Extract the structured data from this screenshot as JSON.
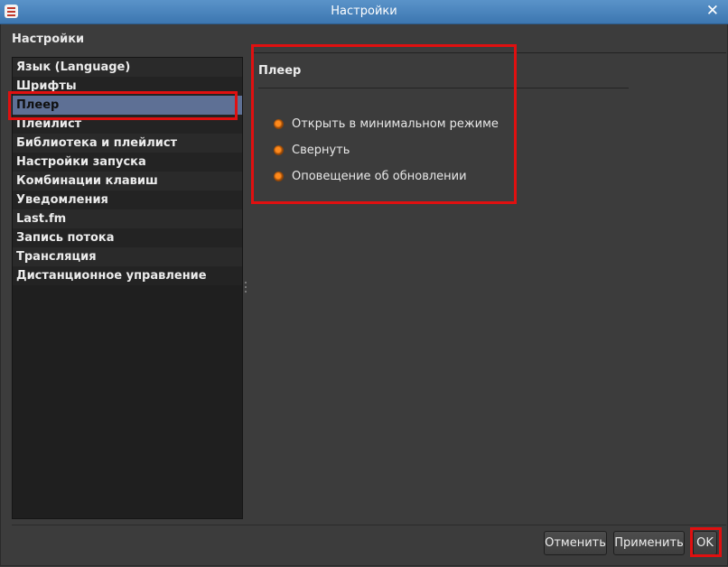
{
  "window": {
    "title": "Настройки",
    "close_glyph": "✕"
  },
  "heading": "Настройки",
  "sidebar": {
    "items": [
      {
        "label": "Язык (Language)",
        "selected": false
      },
      {
        "label": "Шрифты",
        "selected": false
      },
      {
        "label": "Плеер",
        "selected": true
      },
      {
        "label": "Плейлист",
        "selected": false
      },
      {
        "label": "Библиотека и плейлист",
        "selected": false
      },
      {
        "label": "Настройки запуска",
        "selected": false
      },
      {
        "label": "Комбинации клавиш",
        "selected": false
      },
      {
        "label": "Уведомления",
        "selected": false
      },
      {
        "label": "Last.fm",
        "selected": false
      },
      {
        "label": "Запись потока",
        "selected": false
      },
      {
        "label": "Трансляция",
        "selected": false
      },
      {
        "label": "Дистанционное управление",
        "selected": false
      }
    ]
  },
  "panel": {
    "title": "Плеер",
    "options": [
      {
        "label": "Открыть в минимальном режиме",
        "checked": true
      },
      {
        "label": "Свернуть",
        "checked": true
      },
      {
        "label": "Оповещение об обновлении",
        "checked": true
      }
    ]
  },
  "buttons": {
    "cancel": "Отменить",
    "apply": "Применить",
    "ok": "OK"
  },
  "colors": {
    "titlebar": "#4a85bf",
    "background": "#3c3c3c",
    "selection": "#5e7095",
    "checkbox": "#ff8a1c",
    "highlight": "#e01010"
  },
  "icons": {
    "app": "app-icon",
    "close": "close-icon",
    "splitter": "splitter-handle-icon"
  }
}
